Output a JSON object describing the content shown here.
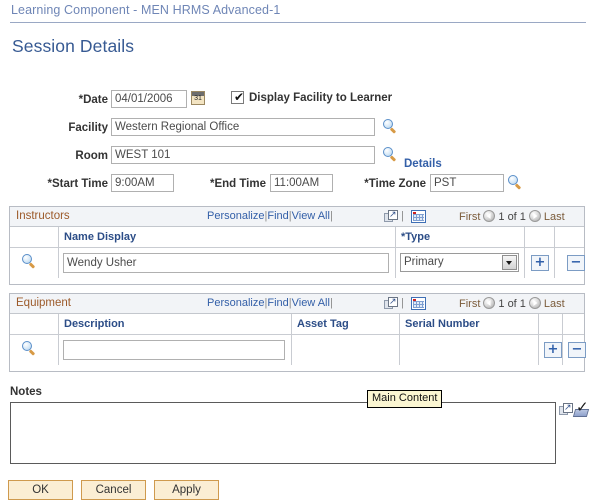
{
  "header": {
    "title": "Learning Component - MEN HRMS Advanced-1"
  },
  "section": {
    "title": "Session Details"
  },
  "form": {
    "date_label": "*Date",
    "date_value": "04/01/2006",
    "calendar_icon_day": "31",
    "display_facility_label": "Display Facility to Learner",
    "display_facility_checked": "✔",
    "facility_label": "Facility",
    "facility_value": "Western Regional Office",
    "room_label": "Room",
    "room_value": "WEST 101",
    "details_link": "Details",
    "start_time_label": "*Start Time",
    "start_time_value": "9:00AM",
    "end_time_label": "*End Time",
    "end_time_value": "11:00AM",
    "time_zone_label": "*Time Zone",
    "time_zone_value": "PST"
  },
  "grid_tools": {
    "personalize": "Personalize",
    "find": "Find",
    "view_all": "View All",
    "sep": "|"
  },
  "pager": {
    "first": "First",
    "count": "1 of 1",
    "last": "Last"
  },
  "instructors": {
    "title": "Instructors",
    "columns": [
      "Name Display",
      "*Type"
    ],
    "rows": [
      {
        "name_display": "Wendy Usher",
        "type": "Primary",
        "add_label": "+",
        "remove_label": "−"
      }
    ]
  },
  "equipment": {
    "title": "Equipment",
    "columns": [
      "Description",
      "Asset Tag",
      "Serial Number"
    ],
    "rows": [
      {
        "description": "",
        "asset_tag": "",
        "serial_number": "",
        "add_label": "+",
        "remove_label": "−"
      }
    ]
  },
  "notes": {
    "label": "Notes",
    "value": "",
    "tooltip": "Main Content"
  },
  "buttons": {
    "ok": "OK",
    "cancel": "Cancel",
    "apply": "Apply"
  },
  "colors": {
    "header_title": "#6f86b6",
    "section_title": "#375a93",
    "grid_title": "#9c5a2a",
    "column_header": "#2c4d87",
    "link": "#335fa8",
    "button_border": "#cf9a4e",
    "button_bg": "#fbeed4",
    "tooltip_bg": "#fbf6d2"
  }
}
